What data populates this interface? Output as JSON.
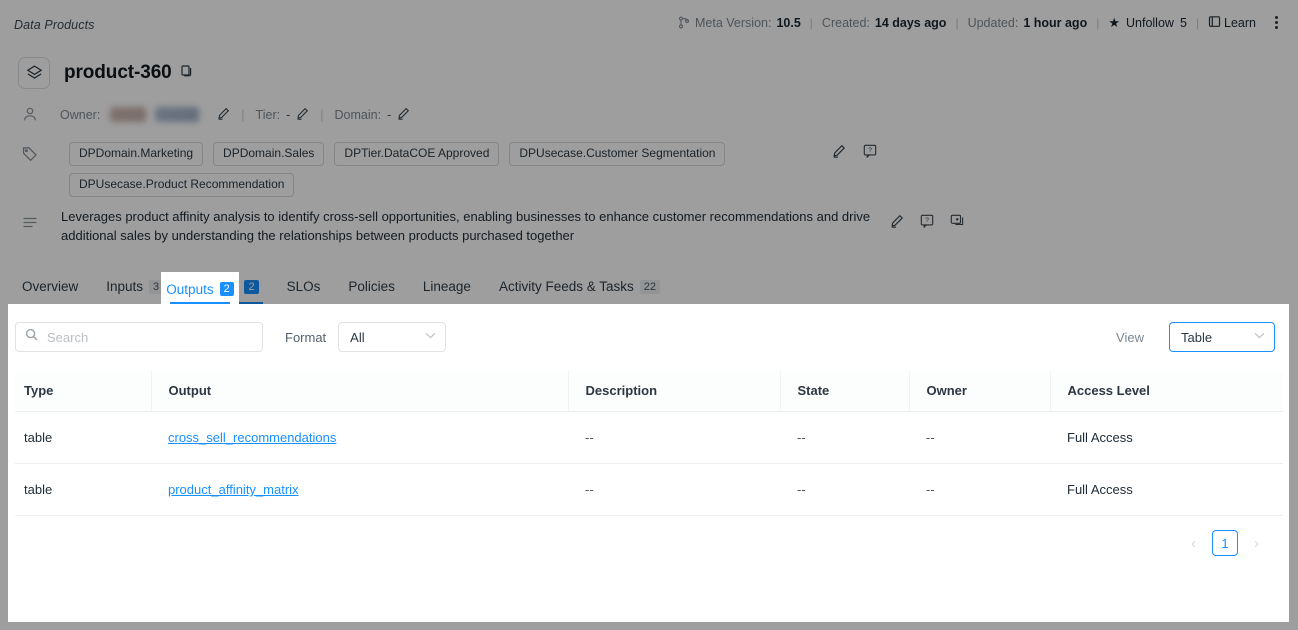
{
  "topbar": {
    "breadcrumb": "Data Products",
    "meta": [
      {
        "icon": "branch-icon",
        "label": "Meta Version:",
        "value": "10.5"
      },
      {
        "label": "Created:",
        "value": "14 days ago"
      },
      {
        "label": "Updated:",
        "value": "1 hour ago"
      }
    ],
    "follow": {
      "icon": "star-icon",
      "label": "Unfollow",
      "count": "5"
    },
    "learn": {
      "icon": "book-icon",
      "label": "Learn"
    },
    "kebab": "more-options"
  },
  "header": {
    "logo_icon": "data-product-icon",
    "title": "product-360",
    "copy_icon": "copy-icon",
    "owner": {
      "person_icon": "person-icon",
      "owner_label": "Owner:",
      "owner_value": "",
      "tier_label": "Tier:",
      "tier_value": "-",
      "domain_label": "Domain:",
      "domain_value": "-",
      "edit_icon": "pencil-icon"
    }
  },
  "tags": {
    "icon": "tag-icon",
    "items": [
      "DPDomain.Marketing",
      "DPDomain.Sales",
      "DPTier.DataCOE Approved",
      "DPUsecase.Customer Segmentation",
      "DPUsecase.Product Recommendation"
    ],
    "actions": [
      "pencil-icon",
      "help-icon"
    ]
  },
  "description": {
    "icon": "description-icon",
    "text": "Leverages product affinity analysis to identify cross-sell opportunities, enabling businesses to enhance customer recommendations and drive additional sales by understanding the relationships between products purchased together",
    "actions": [
      "pencil-icon",
      "help-icon",
      "add-comment-icon"
    ]
  },
  "tabs": [
    {
      "label": "Overview",
      "count": "",
      "active": false
    },
    {
      "label": "Inputs",
      "count": "3",
      "active": false
    },
    {
      "label": "Outputs",
      "count": "2",
      "active": true
    },
    {
      "label": "SLOs",
      "count": "",
      "active": false
    },
    {
      "label": "Policies",
      "count": "",
      "active": false
    },
    {
      "label": "Lineage",
      "count": "",
      "active": false
    },
    {
      "label": "Activity Feeds & Tasks",
      "count": "22",
      "active": false
    }
  ],
  "panel": {
    "search": {
      "icon": "search-icon",
      "placeholder": "Search",
      "value": ""
    },
    "format": {
      "label": "Format",
      "selected": "All",
      "caret": "chevron-down-icon"
    },
    "view": {
      "label": "View",
      "selected": "Table",
      "caret": "chevron-down-icon"
    },
    "table": {
      "columns": [
        "Type",
        "Output",
        "Description",
        "State",
        "Owner",
        "Access Level"
      ],
      "rows": [
        {
          "type": "table",
          "output": "cross_sell_recommendations",
          "description": "--",
          "state": "--",
          "owner": "--",
          "access_level": "Full Access"
        },
        {
          "type": "table",
          "output": "product_affinity_matrix",
          "description": "--",
          "state": "--",
          "owner": "--",
          "access_level": "Full Access"
        }
      ]
    },
    "pagination": {
      "prev": "‹",
      "current": "1",
      "next": "›"
    }
  },
  "colors": {
    "accent": "#1890ff",
    "text": "#1f2b36",
    "muted": "#7c8893",
    "border": "#e0e2e5",
    "scrim": "rgba(0,0,0,0.38)"
  }
}
